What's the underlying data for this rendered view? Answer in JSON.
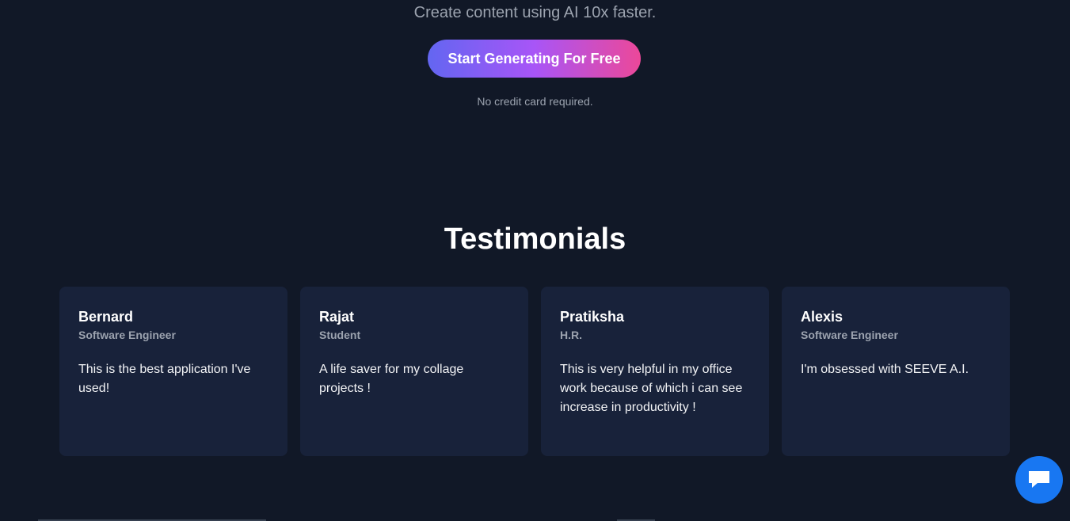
{
  "hero": {
    "tagline": "Create content using AI 10x faster.",
    "cta_label": "Start Generating For Free",
    "note": "No credit card required."
  },
  "testimonials": {
    "title": "Testimonials",
    "items": [
      {
        "name": "Bernard",
        "role": "Software Engineer",
        "quote": "This is the best application I've used!"
      },
      {
        "name": "Rajat",
        "role": "Student",
        "quote": "A life saver for my collage projects !"
      },
      {
        "name": "Pratiksha",
        "role": "H.R.",
        "quote": "This is very helpful in my office work because of which i can see increase in productivity !"
      },
      {
        "name": "Alexis",
        "role": "Software Engineer",
        "quote": "I'm obsessed with SEEVE A.I."
      }
    ]
  },
  "chat": {
    "icon": "chat-bubble-icon"
  },
  "colors": {
    "background": "#111827",
    "card": "#18223a",
    "gradient_start": "#6366f1",
    "gradient_mid": "#a855f7",
    "gradient_end": "#ec4899",
    "chat_button": "#1877f2"
  }
}
